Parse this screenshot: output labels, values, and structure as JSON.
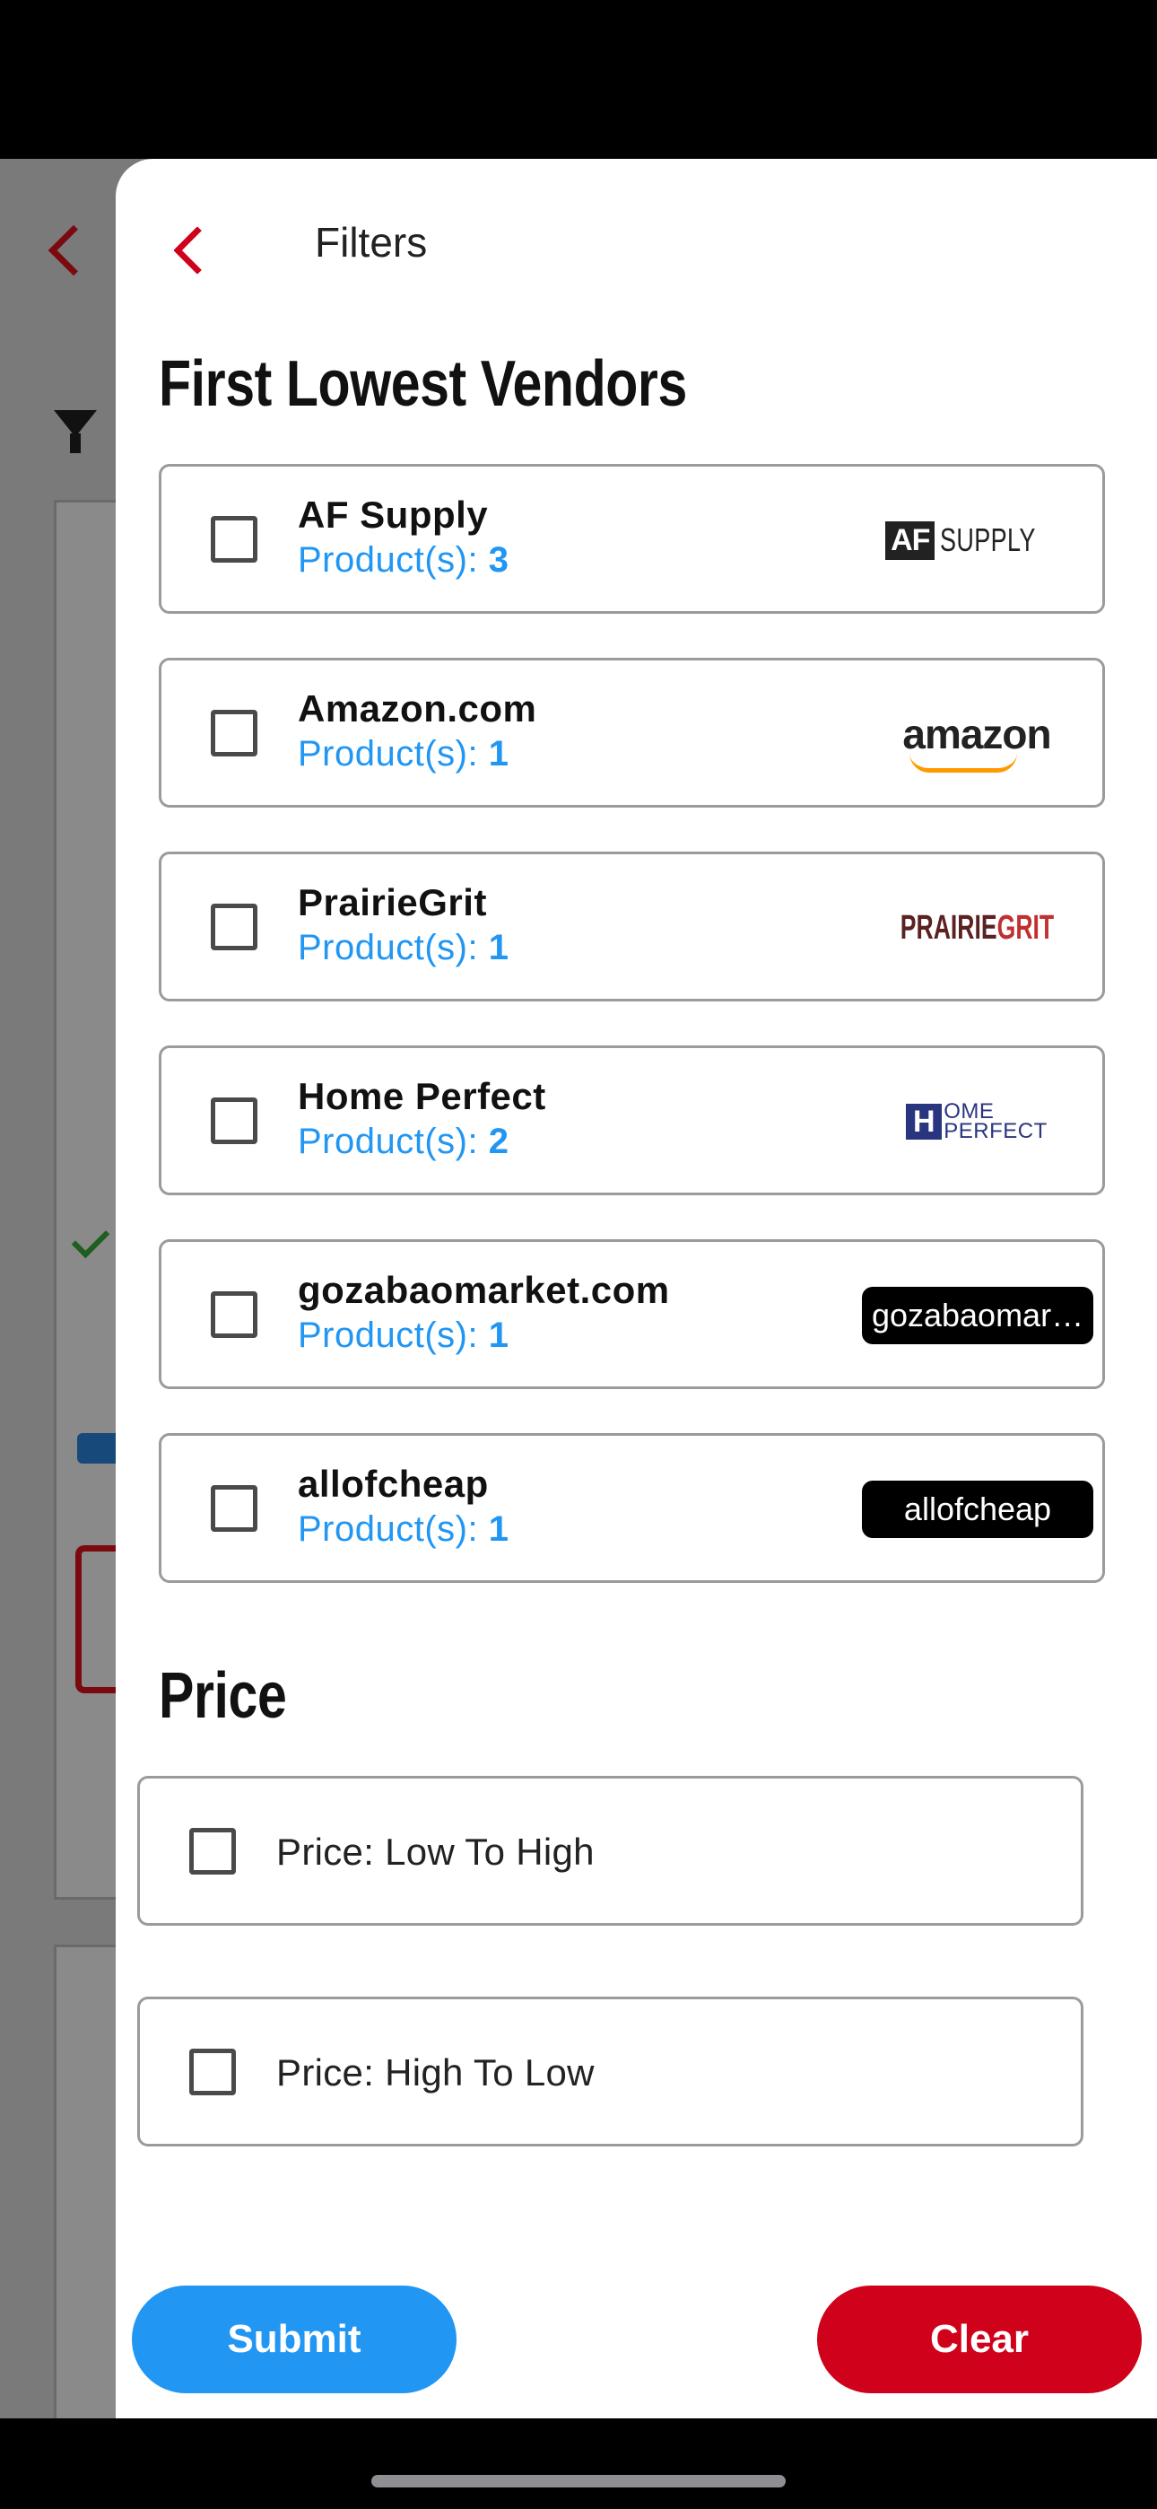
{
  "panel": {
    "title": "Filters"
  },
  "vendors_section": {
    "title": "First Lowest Vendors",
    "count_prefix": "Product(s): ",
    "items": [
      {
        "name": "AF Supply",
        "count": "3",
        "logo": "af-supply-logo"
      },
      {
        "name": "Amazon.com",
        "count": "1",
        "logo": "amazon-logo"
      },
      {
        "name": "PrairieGrit",
        "count": "1",
        "logo": "prairiegrit-logo"
      },
      {
        "name": "Home Perfect",
        "count": "2",
        "logo": "home-perfect-logo"
      },
      {
        "name": "gozabaomarket.com",
        "count": "1",
        "logo_text": "gozabaomar…"
      },
      {
        "name": "allofcheap",
        "count": "1",
        "logo_text": "allofcheap"
      }
    ],
    "logos": {
      "af_mark": "AF",
      "af_text": "SUPPLY",
      "amazon": "amazon",
      "pg_a": "PRAIRIE",
      "pg_b": "GRIT",
      "hp_h": "H",
      "hp_line1": "OME",
      "hp_line2": "PERFECT"
    }
  },
  "price_section": {
    "title": "Price",
    "options": [
      {
        "label": "Price: Low To High"
      },
      {
        "label": "Price: High To Low"
      }
    ]
  },
  "actions": {
    "submit": "Submit",
    "clear": "Clear"
  },
  "colors": {
    "accent_blue": "#2196f3",
    "accent_red": "#d0021b"
  }
}
